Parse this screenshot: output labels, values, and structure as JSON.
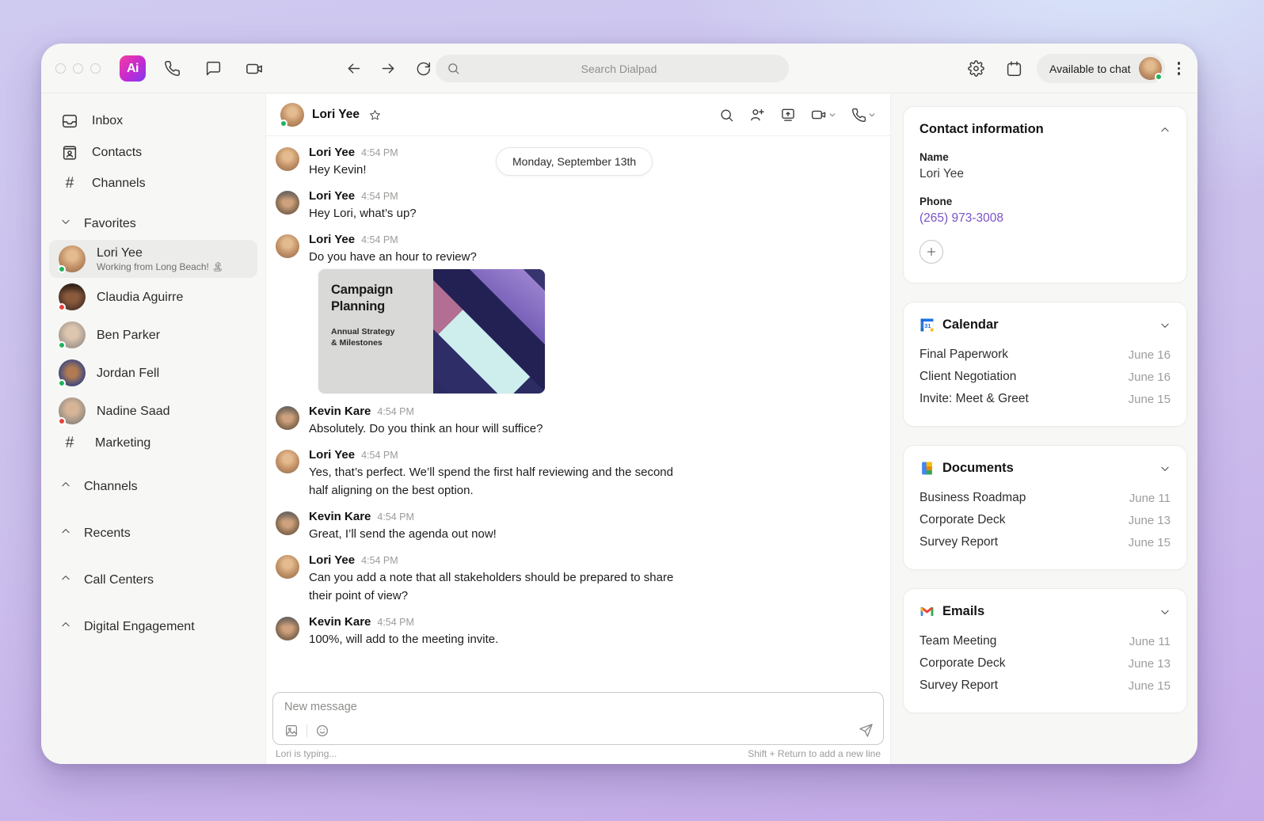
{
  "topbar": {
    "search_placeholder": "Search Dialpad",
    "availability_label": "Available to chat"
  },
  "sidebar": {
    "nav": [
      {
        "label": "Inbox"
      },
      {
        "label": "Contacts"
      },
      {
        "label": "Channels"
      }
    ],
    "favorites_header": "Favorites",
    "favorites": [
      {
        "name": "Lori Yee",
        "status": "Working from Long Beach! 🏝",
        "presence": "green"
      },
      {
        "name": "Claudia Aguirre",
        "presence": "red"
      },
      {
        "name": "Ben Parker",
        "presence": "green"
      },
      {
        "name": "Jordan Fell",
        "presence": "green"
      },
      {
        "name": "Nadine Saad",
        "presence": "red"
      },
      {
        "name": "Marketing",
        "type": "channel"
      }
    ],
    "sections": [
      {
        "label": "Channels"
      },
      {
        "label": "Recents"
      },
      {
        "label": "Call Centers"
      },
      {
        "label": "Digital Engagement"
      }
    ]
  },
  "chat": {
    "contact_name": "Lori Yee",
    "date_separator": "Monday, September 13th",
    "messages": [
      {
        "sender": "Lori Yee",
        "time": "4:54 PM",
        "text": "Hey Kevin!"
      },
      {
        "sender": "Lori Yee",
        "time": "4:54 PM",
        "text": "Hey Lori, what’s up?"
      },
      {
        "sender": "Lori Yee",
        "time": "4:54 PM",
        "text": "Do you have an hour to review?"
      },
      {
        "sender": "Kevin Kare",
        "time": "4:54 PM",
        "text": "Absolutely. Do you think an hour will suffice?"
      },
      {
        "sender": "Lori Yee",
        "time": "4:54 PM",
        "text": "Yes, that’s perfect. We’ll spend the first half reviewing and the second half aligning on the best option."
      },
      {
        "sender": "Kevin Kare",
        "time": "4:54 PM",
        "text": "Great, I’ll send the agenda out now!"
      },
      {
        "sender": "Lori Yee",
        "time": "4:54 PM",
        "text": "Can you add a note that all stakeholders should be prepared to share their point of view?"
      },
      {
        "sender": "Kevin Kare",
        "time": "4:54 PM",
        "text": "100%, will add to the meeting invite."
      }
    ],
    "attachment": {
      "title": "Campaign Planning",
      "subtitle_line1": "Annual Strategy",
      "subtitle_line2": "& Milestones"
    },
    "composer": {
      "placeholder": "New message",
      "typing_indicator": "Lori is typing...",
      "hint": "Shift + Return to add a new line"
    }
  },
  "panel": {
    "contact": {
      "title": "Contact information",
      "name_label": "Name",
      "name": "Lori Yee",
      "phone_label": "Phone",
      "phone": "(265) 973-3008"
    },
    "calendar": {
      "title": "Calendar",
      "items": [
        {
          "label": "Final Paperwork",
          "date": "June 16"
        },
        {
          "label": "Client Negotiation",
          "date": "June 16"
        },
        {
          "label": "Invite: Meet & Greet",
          "date": "June 15"
        }
      ]
    },
    "documents": {
      "title": "Documents",
      "items": [
        {
          "label": "Business Roadmap",
          "date": "June 11"
        },
        {
          "label": "Corporate Deck",
          "date": "June 13"
        },
        {
          "label": "Survey Report",
          "date": "June 15"
        }
      ]
    },
    "emails": {
      "title": "Emails",
      "items": [
        {
          "label": "Team Meeting",
          "date": "June 11"
        },
        {
          "label": "Corporate Deck",
          "date": "June 13"
        },
        {
          "label": "Survey Report",
          "date": "June 15"
        }
      ]
    }
  },
  "brand": {
    "logo_text": "Ai"
  },
  "colors": {
    "accent_purple": "#7a52c7",
    "presence_green": "#1fb45c",
    "presence_red": "#e8413c",
    "brand_gradient_start": "#f63ba2",
    "brand_gradient_end": "#7e3bf0"
  }
}
